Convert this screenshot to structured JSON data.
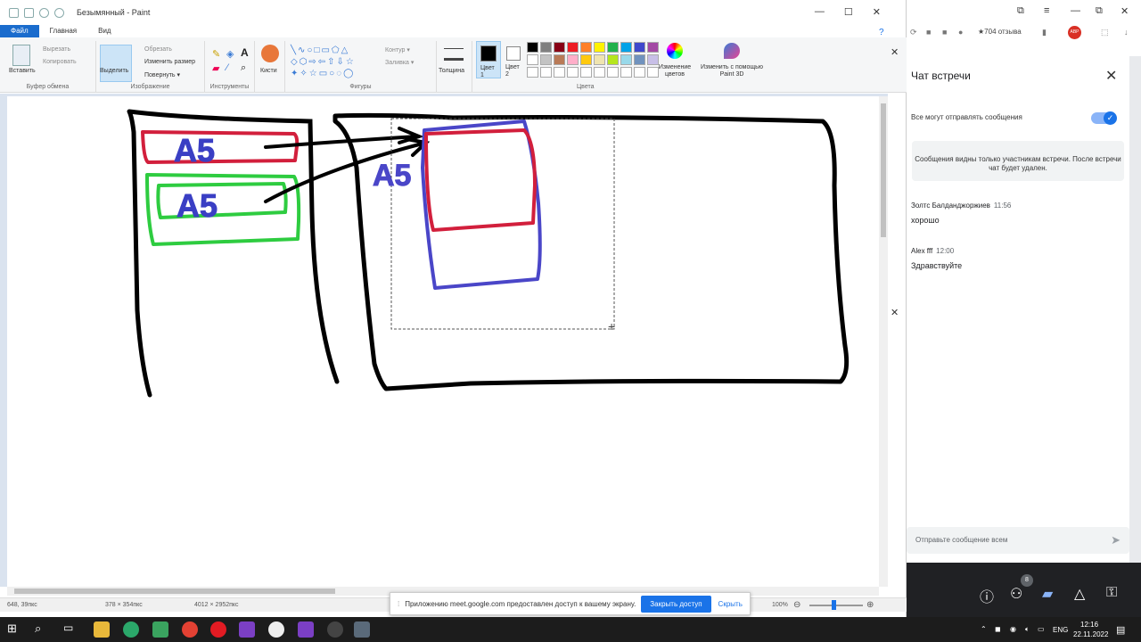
{
  "window": {
    "title": "Безымянный - Paint",
    "controls": [
      "—",
      "☐",
      "✕"
    ]
  },
  "menu": {
    "items": [
      "Файл",
      "Главная",
      "Вид"
    ]
  },
  "ribbon": {
    "clipboard": {
      "paste": "Вставить",
      "cut": "Вырезать",
      "copy": "Копировать",
      "label": "Буфер обмена"
    },
    "image": {
      "select": "Выделить",
      "crop": "Обрезать",
      "resize": "Изменить размер",
      "rotate": "Повернуть ▾",
      "label": "Изображение"
    },
    "tools": {
      "label": "Инструменты"
    },
    "brushes": {
      "label": "Кисти"
    },
    "shapes": {
      "outline": "Контур ▾",
      "fill": "Заливка ▾",
      "label": "Фигуры"
    },
    "size": {
      "label": "Толщина"
    },
    "color1": {
      "label": "Цвет 1"
    },
    "color2": {
      "label": "Цвет 2"
    },
    "colors": {
      "label": "Цвета",
      "edit": "Изменение цветов"
    },
    "paint3d": {
      "label": "Изменить с помощью Paint 3D"
    },
    "palette": [
      "#000000",
      "#7f7f7f",
      "#880015",
      "#ed1c24",
      "#ff7f27",
      "#fff200",
      "#22b14c",
      "#00a2e8",
      "#3f48cc",
      "#a349a4",
      "#ffffff",
      "#c3c3c3",
      "#b97a57",
      "#ffaec9",
      "#ffc90e",
      "#efe4b0",
      "#b5e61d",
      "#99d9ea",
      "#7092be",
      "#c8bfe7",
      "#ffffff",
      "#ffffff",
      "#ffffff",
      "#ffffff",
      "#ffffff",
      "#ffffff",
      "#ffffff",
      "#ffffff",
      "#ffffff",
      "#ffffff"
    ]
  },
  "canvas": {
    "label_top": "A5",
    "label_bottom": "A5",
    "label_pasted": "A5"
  },
  "status": {
    "cursor": "648, 39пкс",
    "selection": "378 × 354пкс",
    "canvas_size": "4012 × 2952пкс",
    "zoom": "100%"
  },
  "share_bar": {
    "text": "Приложению meet.google.com предоставлен доступ к вашему экрану.",
    "stop": "Закрыть доступ",
    "hide": "Скрыть"
  },
  "browser": {
    "rating": "★704 отзыва",
    "abp": "ABP"
  },
  "chat": {
    "title": "Чат встречи",
    "toggle_label": "Все могут отправлять сообщения",
    "toggle_on": true,
    "note": "Сообщения видны только участникам встречи. После встречи чат будет удален.",
    "messages": [
      {
        "name": "Золтс Балданджоржиев",
        "time": "11:56",
        "text": "хорошо"
      },
      {
        "name": "Alex fff",
        "time": "12:00",
        "text": "Здравствуйте"
      }
    ],
    "input_placeholder": "Отправьте сообщение всем"
  },
  "meet": {
    "participants_count": "8"
  },
  "taskbar": {
    "lang": "ENG",
    "time": "12:16",
    "date": "22.11.2022"
  }
}
